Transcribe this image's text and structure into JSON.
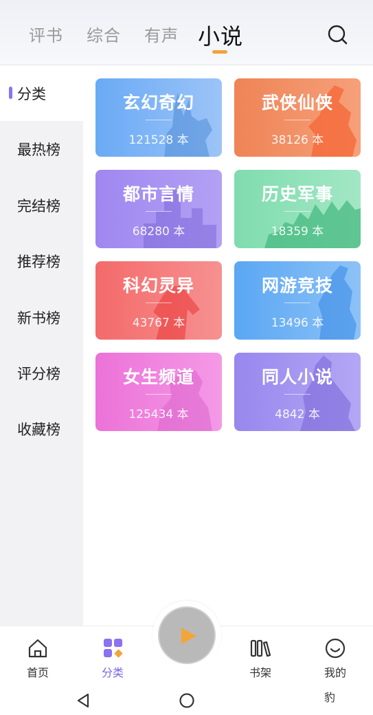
{
  "tabs": [
    {
      "label": "评书"
    },
    {
      "label": "综合"
    },
    {
      "label": "有声"
    },
    {
      "label": "小说"
    }
  ],
  "active_tab": "小说",
  "sidebar": {
    "items": [
      {
        "label": "分类"
      },
      {
        "label": "最热榜"
      },
      {
        "label": "完结榜"
      },
      {
        "label": "推荐榜"
      },
      {
        "label": "新书榜"
      },
      {
        "label": "评分榜"
      },
      {
        "label": "收藏榜"
      }
    ],
    "active": "分类"
  },
  "categories": [
    {
      "name": "玄幻奇幻",
      "count": "121528 本",
      "color_from": "#6aaaf5",
      "color_to": "#9cc4f7"
    },
    {
      "name": "武侠仙侠",
      "count": "38126 本",
      "color_from": "#ef8456",
      "color_to": "#f6a07a"
    },
    {
      "name": "都市言情",
      "count": "68280 本",
      "color_from": "#9f87f0",
      "color_to": "#b3a1f4"
    },
    {
      "name": "历史军事",
      "count": "18359 本",
      "color_from": "#7fdcae",
      "color_to": "#a3e7c5"
    },
    {
      "name": "科幻灵异",
      "count": "43767 本",
      "color_from": "#f46a6a",
      "color_to": "#f79191"
    },
    {
      "name": "网游竞技",
      "count": "13496 本",
      "color_from": "#5aa7f3",
      "color_to": "#8dc2f7"
    },
    {
      "name": "女生频道",
      "count": "125434 本",
      "color_from": "#ec72d8",
      "color_to": "#f49ae6"
    },
    {
      "name": "同人小说",
      "count": "4842 本",
      "color_from": "#9887ee",
      "color_to": "#b4a7f4"
    }
  ],
  "bottom_nav": [
    {
      "label": "首页",
      "icon": "home-icon"
    },
    {
      "label": "分类",
      "icon": "category-icon"
    },
    {
      "label": "书架",
      "icon": "bookshelf-icon"
    },
    {
      "label": "我的",
      "icon": "smile-icon"
    }
  ],
  "bottom_extra_text": "豹",
  "colors": {
    "accent": "#8a72f0",
    "tab_underline": "#f0a23a",
    "play_triangle": "#f3a53a"
  }
}
